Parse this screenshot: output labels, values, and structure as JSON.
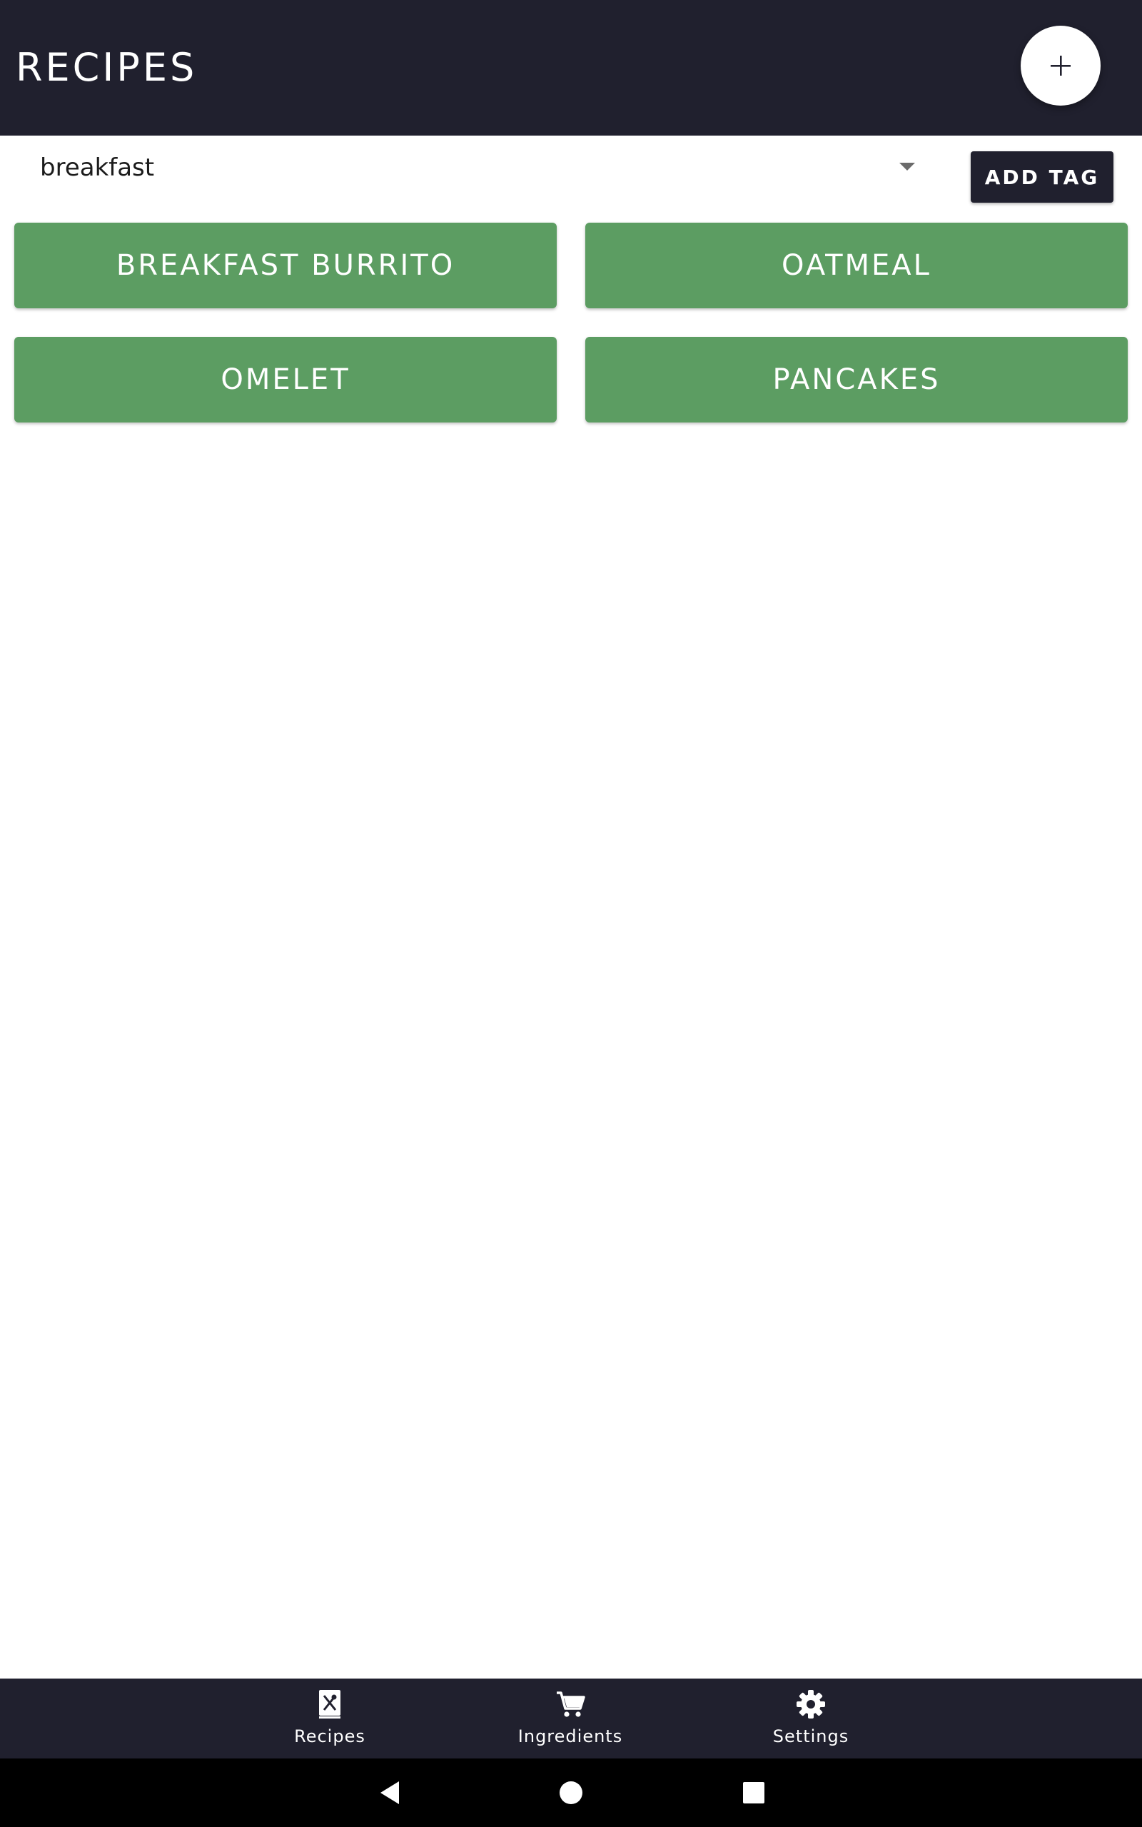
{
  "app_bar": {
    "title": "RECIPES",
    "fab_icon": "add-icon"
  },
  "tag_filter": {
    "selected": "breakfast",
    "caret_icon": "dropdown-arrow-icon",
    "add_tag_label": "ADD TAG"
  },
  "recipes": [
    {
      "name": "BREAKFAST BURRITO"
    },
    {
      "name": "OATMEAL"
    },
    {
      "name": "OMELET"
    },
    {
      "name": "PANCAKES"
    }
  ],
  "bottom_nav": {
    "items": [
      {
        "label": "Recipes",
        "icon": "recipe-book-icon"
      },
      {
        "label": "Ingredients",
        "icon": "shopping-cart-icon"
      },
      {
        "label": "Settings",
        "icon": "gear-icon"
      }
    ]
  },
  "system_nav": {
    "back_icon": "back-triangle-icon",
    "home_icon": "home-circle-icon",
    "recents_icon": "recents-square-icon"
  },
  "colors": {
    "primary_dark": "#20202e",
    "recipe_green": "#5c9d62",
    "background": "#ffffff"
  }
}
